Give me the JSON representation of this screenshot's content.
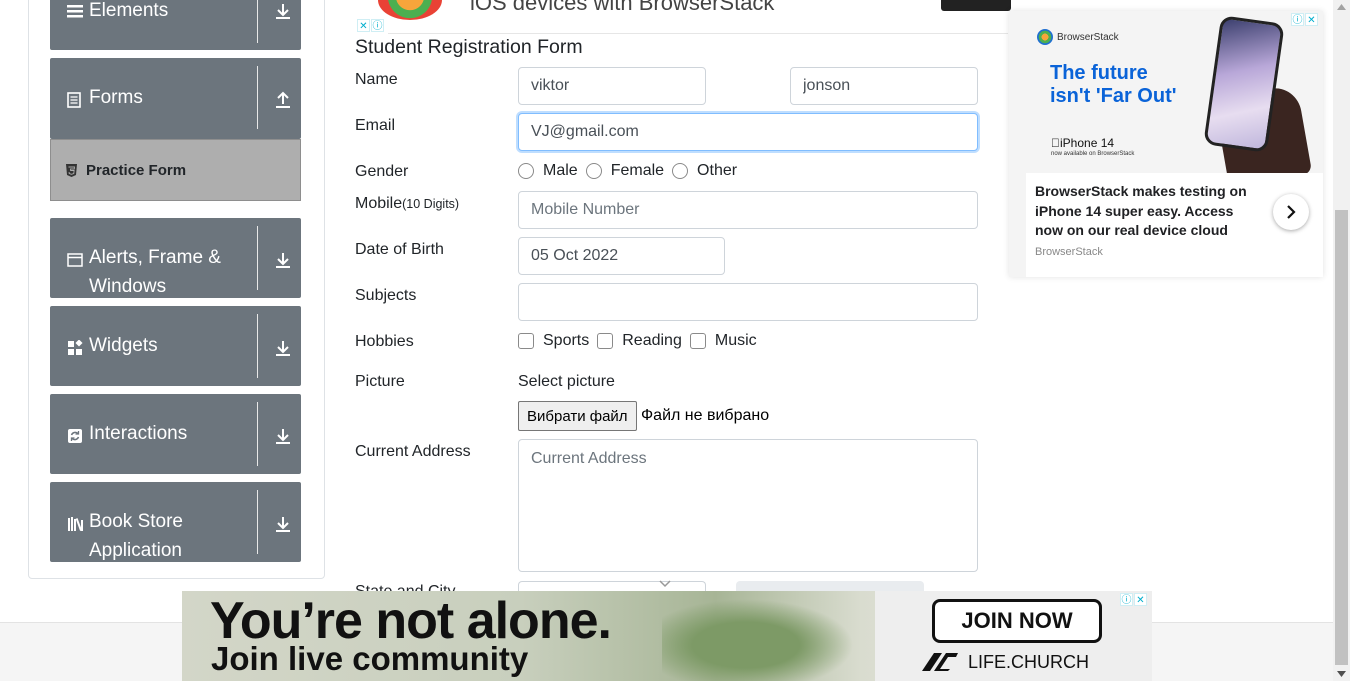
{
  "sidebar": {
    "groups": [
      {
        "title": "Elements",
        "icon": "list-icon",
        "arrow": "download-arrow-icon"
      },
      {
        "title": "Forms",
        "icon": "document-icon",
        "arrow": "upload-arrow-icon",
        "expanded": true
      },
      {
        "title": "Alerts, Frame & Windows",
        "title_line1": "Alerts, Frame &",
        "title_line2": "Windows",
        "icon": "window-icon",
        "arrow": "download-arrow-icon"
      },
      {
        "title": "Widgets",
        "icon": "widgets-icon",
        "arrow": "download-arrow-icon"
      },
      {
        "title": "Interactions",
        "icon": "sync-icon",
        "arrow": "download-arrow-icon"
      },
      {
        "title": "Book Store Application",
        "title_line1": "Book Store",
        "title_line2": "Application",
        "icon": "books-icon",
        "arrow": "download-arrow-icon"
      }
    ],
    "active_item": {
      "label": "Practice Form",
      "icon": "html5-icon"
    }
  },
  "top_ad": {
    "text": "iOS devices with BrowserStack",
    "adchoice_close": "✕",
    "adchoice_info": "ⓘ"
  },
  "form": {
    "title": "Student Registration Form",
    "name_label": "Name",
    "first_name_value": "viktor",
    "last_name_value": "jonson",
    "email_label": "Email",
    "email_value": "VJ@gmail.com",
    "gender_label": "Gender",
    "gender_options": [
      "Male",
      "Female",
      "Other"
    ],
    "mobile_label": "Mobile",
    "mobile_hint": "(10 Digits)",
    "mobile_placeholder": "Mobile Number",
    "dob_label": "Date of Birth",
    "dob_value": "05 Oct 2022",
    "subjects_label": "Subjects",
    "hobbies_label": "Hobbies",
    "hobbies_options": [
      "Sports",
      "Reading",
      "Music"
    ],
    "picture_label": "Picture",
    "select_picture_text": "Select picture",
    "file_button_label": "Вибрати файл",
    "file_status": "Файл не вибрано",
    "address_label": "Current Address",
    "address_placeholder": "Current Address",
    "state_city_label": "State and City"
  },
  "right_ad": {
    "brand_logo_text": "BrowserStack",
    "headline": "The future isn't 'Far Out'",
    "headline_line1": "The future",
    "headline_line2": "isn't 'Far Out'",
    "product": "iPhone 14",
    "product_sub": "now available on BrowserStack",
    "body": "BrowserStack makes testing on iPhone 14 super easy. Access now on our real device cloud",
    "brand": "BrowserStack",
    "info": "ⓘ",
    "close": "✕"
  },
  "bottom_ad": {
    "headline": "You’re not alone.",
    "subline": "Join live community",
    "cta": "JOIN NOW",
    "brand": "LIFE.CHURCH",
    "info": "ⓘ",
    "close": "✕"
  },
  "colors": {
    "sidebar_group_bg": "#6c757d",
    "active_item_bg": "#aeaeae",
    "focus_border": "#80bdff",
    "ad_headline_blue": "#0a63d8"
  }
}
